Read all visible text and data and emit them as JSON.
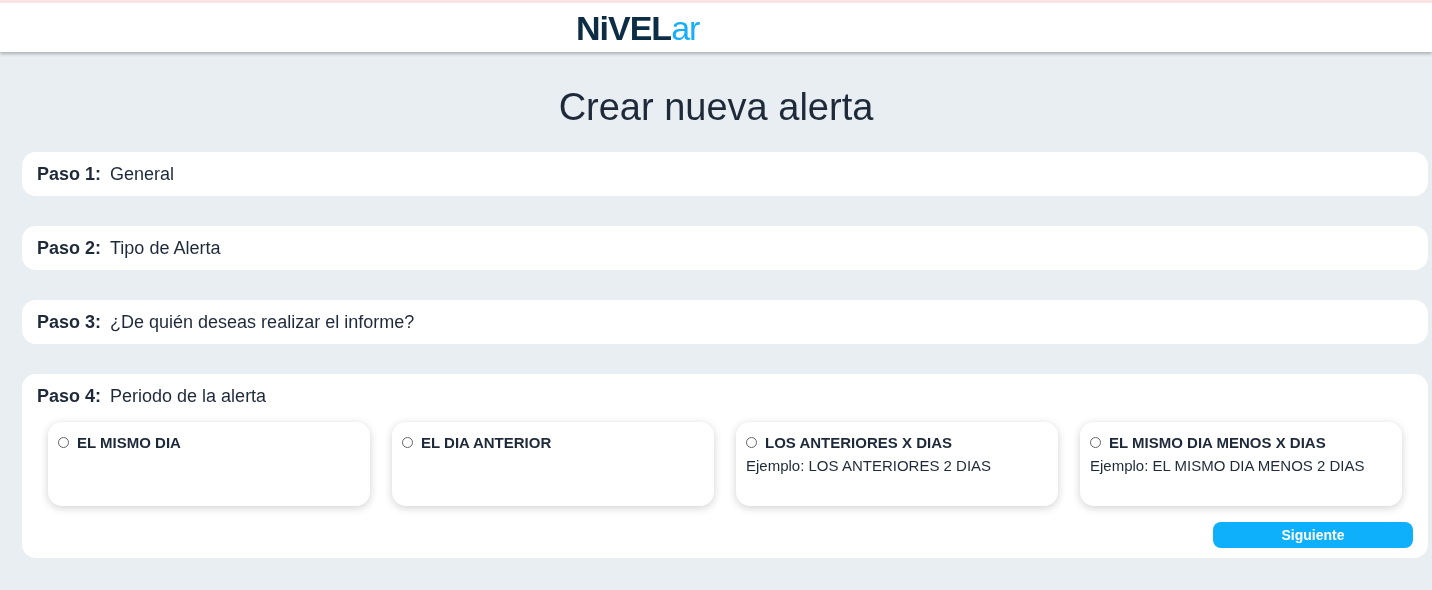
{
  "logo": [
    {
      "text": "NiVEL",
      "color": "#0d2d45"
    },
    {
      "text": "ar",
      "color": "#13aefc"
    }
  ],
  "title": "Crear nueva alerta",
  "steps": [
    {
      "label": "Paso 1:",
      "text": "General"
    },
    {
      "label": "Paso 2:",
      "text": "Tipo de Alerta"
    },
    {
      "label": "Paso 3:",
      "text": "¿De quién deseas realizar el informe?"
    },
    {
      "label": "Paso 4:",
      "text": "Periodo de la alerta",
      "options": [
        {
          "label": "EL MISMO DIA",
          "selected": false
        },
        {
          "label": "EL DIA ANTERIOR",
          "selected": false
        },
        {
          "label": "LOS ANTERIORES X DIAS",
          "example": "Ejemplo: LOS ANTERIORES 2 DIAS",
          "selected": false
        },
        {
          "label": "EL MISMO DIA MENOS X DIAS",
          "example": "Ejemplo: EL MISMO DIA MENOS 2 DIAS",
          "selected": false
        }
      ],
      "button": "Siguiente"
    }
  ]
}
